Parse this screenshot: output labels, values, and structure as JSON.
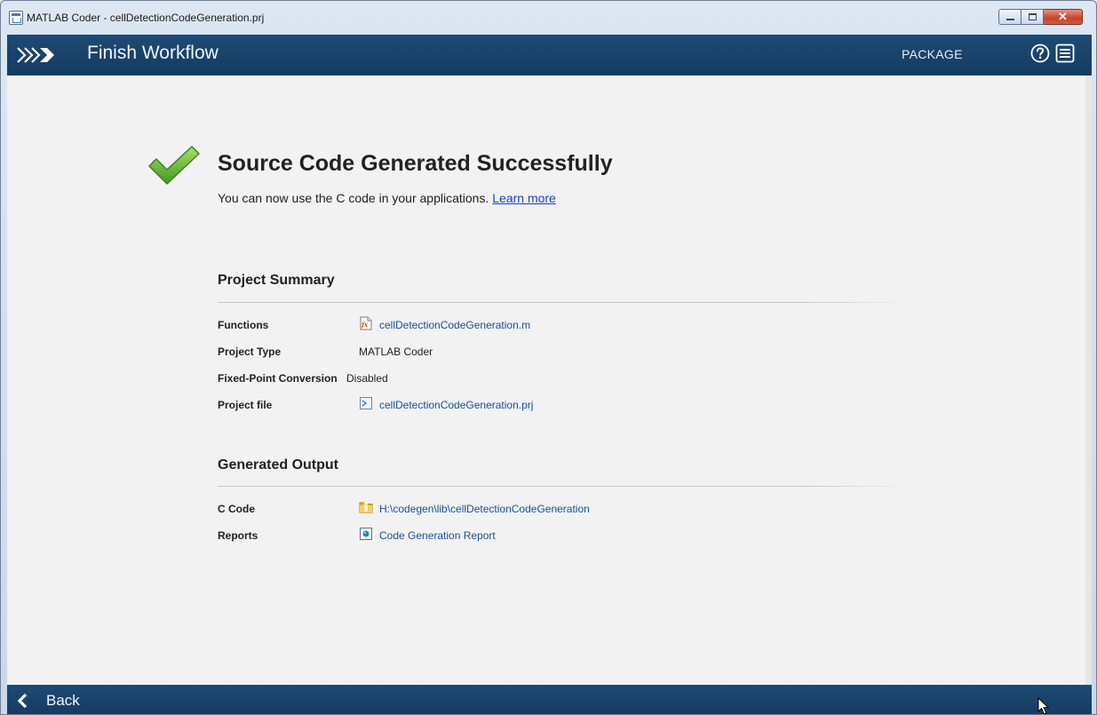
{
  "window": {
    "title": "MATLAB Coder - cellDetectionCodeGeneration.prj",
    "close_glyph": "✕"
  },
  "header": {
    "title": "Finish Workflow",
    "package_label": "PACKAGE",
    "icons": [
      "workflow-chevrons-icon",
      "help-icon",
      "menu-icon"
    ]
  },
  "success": {
    "title": "Source Code Generated Successfully",
    "subtitle": "You can now use the C code in your applications.",
    "learn_more": "Learn more",
    "icon": "checkmark-icon"
  },
  "project_summary": {
    "title": "Project Summary",
    "functions_label": "Functions",
    "functions_value": "cellDetectionCodeGeneration.m",
    "project_type_label": "Project Type",
    "project_type_value": "MATLAB Coder",
    "fixed_point_label": "Fixed-Point Conversion",
    "fixed_point_value": "Disabled",
    "project_file_label": "Project file",
    "project_file_value": "cellDetectionCodeGeneration.prj"
  },
  "generated_output": {
    "title": "Generated Output",
    "c_code_label": "C Code",
    "c_code_value": "H:\\codegen\\lib\\cellDetectionCodeGeneration",
    "reports_label": "Reports",
    "reports_value": "Code Generation Report"
  },
  "footer": {
    "back_label": "Back"
  },
  "colors": {
    "header_bg": "#1d4a75",
    "link": "#1b4f9a",
    "learn_more": "#1a3fd0",
    "check_green": "#5cb82f"
  }
}
